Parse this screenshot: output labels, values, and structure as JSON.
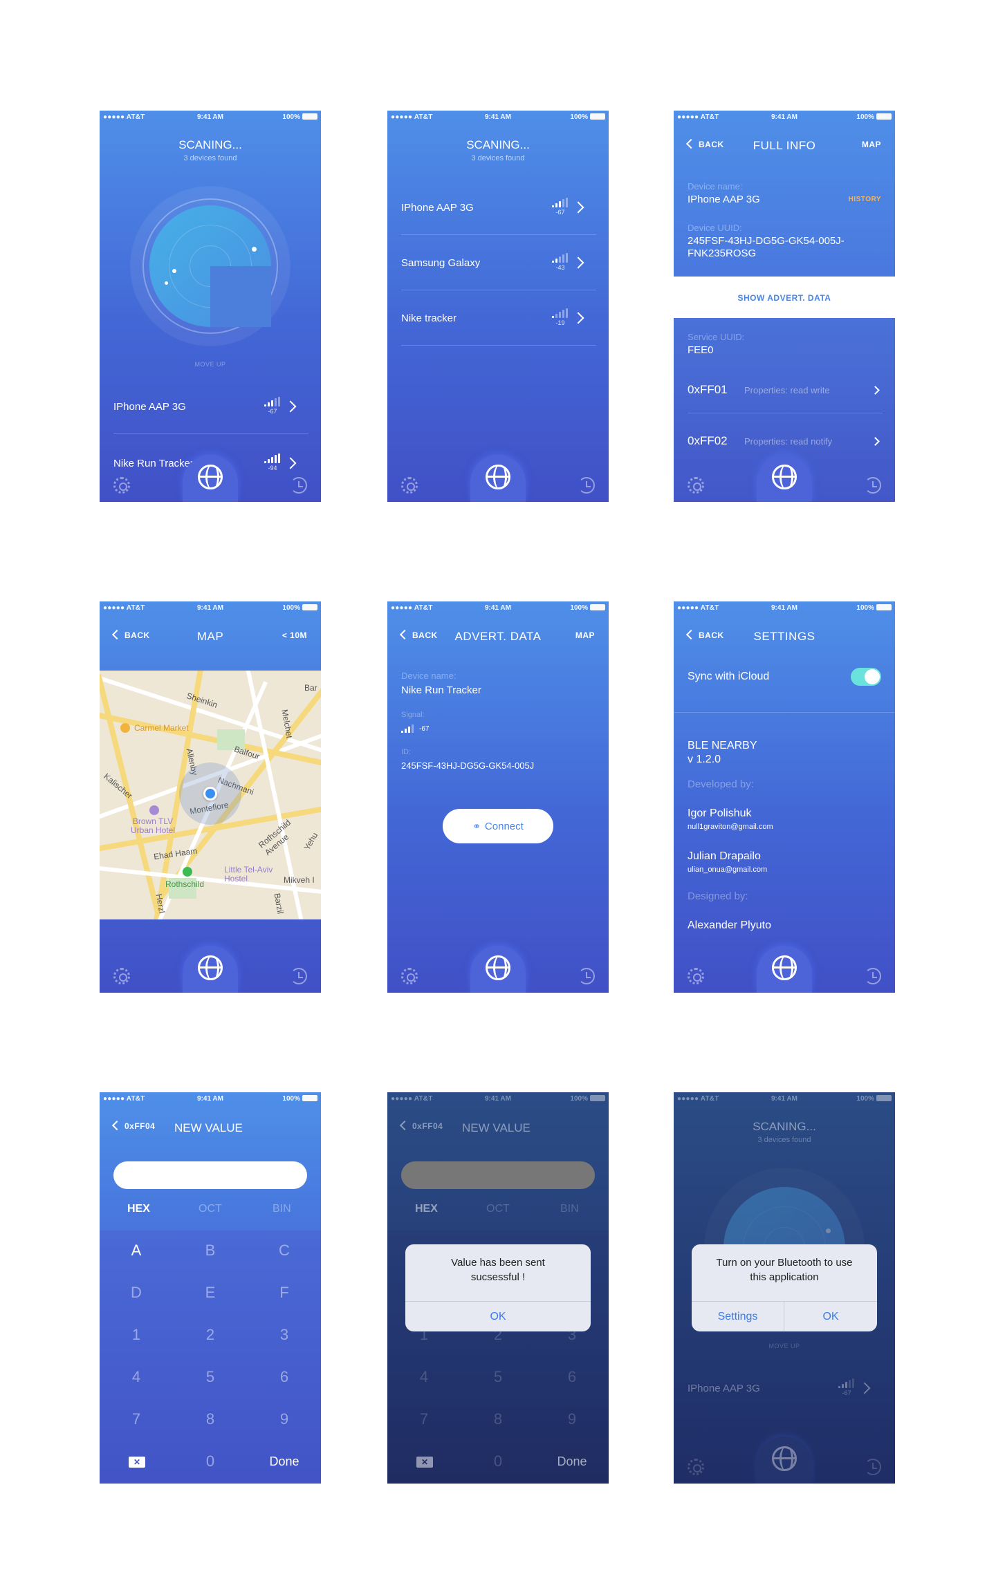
{
  "status": {
    "carrier": "●●●●● AT&T",
    "time": "9:41 AM",
    "battery": "100%"
  },
  "scan": {
    "title": "SCANING...",
    "subtitle": "3 devices found",
    "move_up": "MOVE UP",
    "devices": [
      {
        "name": "IPhone AAP 3G",
        "rssi": "-67"
      },
      {
        "name": "Nike Run Tracker",
        "rssi": "-94"
      }
    ]
  },
  "list": {
    "title": "SCANING...",
    "subtitle": "3 devices found",
    "devices": [
      {
        "name": "IPhone AAP 3G",
        "rssi": "-67"
      },
      {
        "name": "Samsung Galaxy",
        "rssi": "-43"
      },
      {
        "name": "Nike tracker",
        "rssi": "-19"
      }
    ]
  },
  "full_info": {
    "back": "BACK",
    "title": "FULL INFO",
    "right": "MAP",
    "device_name_label": "Device name:",
    "device_name": "IPhone AAP 3G",
    "history": "HISTORY",
    "uuid_label": "Device UUID:",
    "uuid": "245FSF-43HJ-DG5G-GK54-005J-FNK235ROSG",
    "show_advert": "SHOW ADVERT. DATA",
    "service_label": "Service UUID:",
    "service": "FEE0",
    "props": [
      {
        "key": "0xFF01",
        "desc": "Properties: read write"
      },
      {
        "key": "0xFF02",
        "desc": "Properties: read notify"
      }
    ]
  },
  "map": {
    "back": "BACK",
    "title": "MAP",
    "right": "< 10M",
    "labels": [
      "Sheinkin",
      "Carmel Market",
      "Balfour",
      "Allenby",
      "Nachmani",
      "Montefiore",
      "Brown TLV Urban Hotel",
      "Ehad Haam",
      "Rothschild Avenue",
      "Rothschild",
      "Little Tel-Aviv Hostel",
      "Mikveh I",
      "Kalischer",
      "Melchet",
      "Yehu",
      "Bar",
      "Herzl",
      "Barzil"
    ]
  },
  "advert": {
    "back": "BACK",
    "title": "ADVERT. DATA",
    "right": "MAP",
    "name_label": "Device name:",
    "name": "Nike Run Tracker",
    "signal_label": "Signal:",
    "signal": "-67",
    "id_label": "ID:",
    "id": "245FSF-43HJ-DG5G-GK54-005J",
    "connect": "Connect"
  },
  "settings": {
    "back": "BACK",
    "title": "SETTINGS",
    "sync": "Sync with iCloud",
    "app": "BLE NEARBY",
    "version": "v 1.2.0",
    "developed_by": "Developed by:",
    "dev1": "Igor Polishuk",
    "dev1_email": "null1graviton@gmail.com",
    "dev2": "Julian Drapailo",
    "dev2_email": "ulian_onua@gmail.com",
    "designed_by": "Designed by:",
    "designer": "Alexander Plyuto"
  },
  "newval": {
    "back": "0xFF04",
    "title": "NEW VALUE",
    "tabs": [
      "HEX",
      "OCT",
      "BIN"
    ],
    "keys": [
      "A",
      "B",
      "C",
      "D",
      "E",
      "F",
      "1",
      "2",
      "3",
      "4",
      "5",
      "6",
      "7",
      "8",
      "9"
    ],
    "zero": "0",
    "done": "Done"
  },
  "alert1": {
    "message": "Value has been sent sucsessful !",
    "ok": "OK"
  },
  "alert2": {
    "message": "Turn on your Bluetooth to use this application",
    "settings": "Settings",
    "ok": "OK"
  }
}
